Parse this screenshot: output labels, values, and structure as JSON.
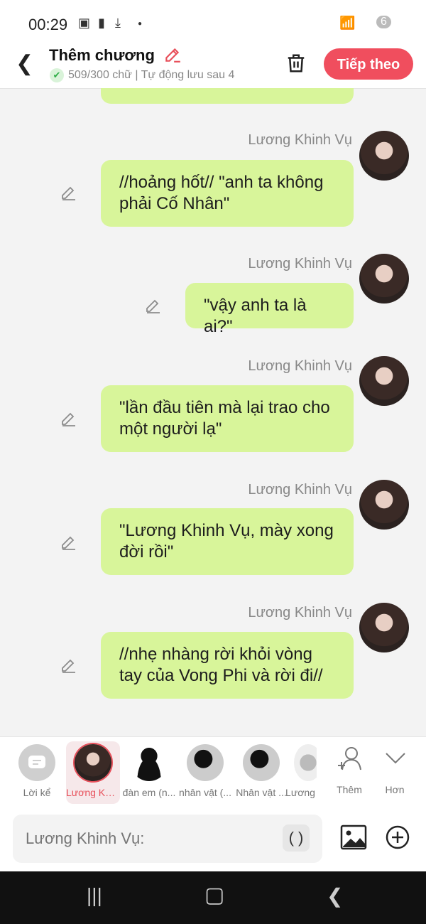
{
  "status_bar": {
    "time": "00:29",
    "notif_count": "6"
  },
  "header": {
    "title": "Thêm chương",
    "word_status": "509/300 chữ | Tự động lưu sau 4",
    "next_label": "Tiếp theo"
  },
  "messages": [
    {
      "sender": "Lương Khinh Vụ",
      "text": "//hoảng hốt// \"anh ta không phải Cố Nhân\""
    },
    {
      "sender": "Lương Khinh Vụ",
      "text": "\"vậy anh ta là ai?\""
    },
    {
      "sender": "Lương Khinh Vụ",
      "text": "\"lần đầu tiên mà lại trao cho một người lạ\""
    },
    {
      "sender": "Lương Khinh Vụ",
      "text": "\"Lương Khinh Vụ, mày xong đời rồi\""
    },
    {
      "sender": "Lương Khinh Vụ",
      "text": "//nhẹ nhàng rời khỏi vòng tay của Vong Phi và rời đi//"
    }
  ],
  "characters": [
    {
      "label": "Lời kể"
    },
    {
      "label": "Lương Khi..."
    },
    {
      "label": "đàn em (n..."
    },
    {
      "label": "nhân vật (..."
    },
    {
      "label": "Nhân vật ..."
    },
    {
      "label": "Lương"
    },
    {
      "label": "Thêm"
    },
    {
      "label": "Hơn"
    }
  ],
  "composer": {
    "placeholder": "Lương Khinh Vụ:",
    "paren": "( )"
  },
  "colors": {
    "accent": "#f04e5e",
    "bubble": "#d8f59a"
  }
}
